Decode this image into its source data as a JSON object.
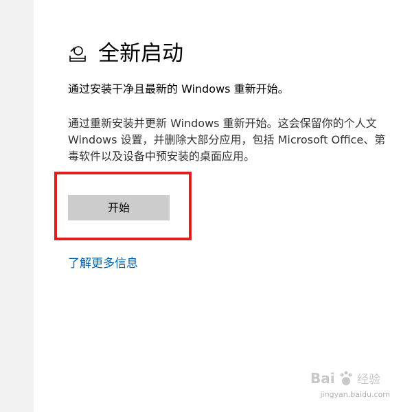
{
  "header": {
    "icon": "fresh-start-icon",
    "title": "全新启动"
  },
  "subtitle": "通过安装干净且最新的 Windows 重新开始。",
  "description": {
    "lines": [
      "通过重新安装并更新 Windows 重新开始。这会保留你的个人文",
      "Windows 设置，并删除大部分应用，包括 Microsoft Office、第",
      "毒软件以及设备中预安装的桌面应用。"
    ]
  },
  "start_button": {
    "label": "开始"
  },
  "learn_more": {
    "label": "了解更多信息"
  },
  "watermark": {
    "logo_text": "Bai",
    "logo_suffix": "经验",
    "url": "jingyan.baidu.com"
  },
  "colors": {
    "left_pane": "#f2f2f2",
    "highlight": "#e0201f",
    "button": "#cccccc",
    "link": "#0063b1"
  }
}
